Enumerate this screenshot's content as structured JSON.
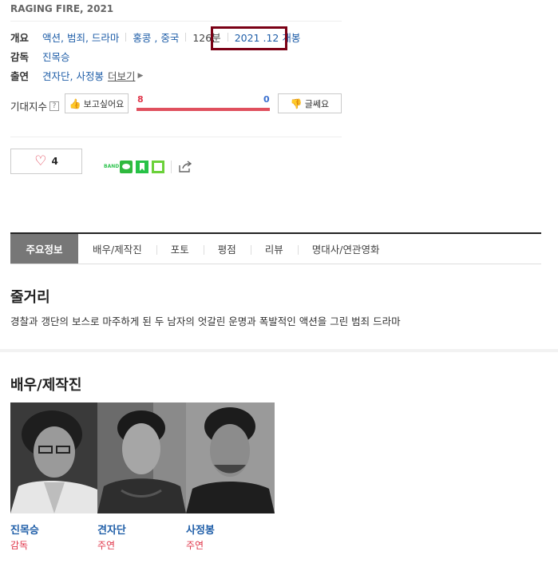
{
  "movie": {
    "english_title": "RAGING FIRE, 2021",
    "overview_label": "개요",
    "genre": "액션, 범죄, 드라마",
    "country": "홍콩 , 중국",
    "runtime": "126분",
    "release": "2021 .12 개봉",
    "director_label": "감독",
    "director": "진목승",
    "cast_label": "출연",
    "cast_list": "견자단, 사정봉",
    "more_label": "더보기"
  },
  "expectation": {
    "label": "기대지수",
    "help": "?",
    "want_label": "보고싶어요",
    "want_count": "8",
    "bad_label": "글쎄요",
    "bad_count": "0"
  },
  "like": {
    "count": "4"
  },
  "share": {
    "band_text": "BAND"
  },
  "tabs": [
    "주요정보",
    "배우/제작진",
    "포토",
    "평점",
    "리뷰",
    "명대사/연관영화"
  ],
  "synopsis": {
    "title": "줄거리",
    "text": "경찰과 갱단의 보스로 마주하게 된 두 남자의 엇갈린 운명과 폭발적인 액션을 그린 범죄 드라마"
  },
  "crew_section": {
    "title": "배우/제작진",
    "people": [
      {
        "name": "진목승",
        "role": "감독"
      },
      {
        "name": "견자단",
        "role": "주연"
      },
      {
        "name": "사정봉",
        "role": "주연"
      }
    ]
  },
  "colors": {
    "link": "#1f5ea8",
    "accent_red": "#e0374b",
    "accent_blue": "#3a6fcf",
    "highlight_box": "#7a0015"
  }
}
